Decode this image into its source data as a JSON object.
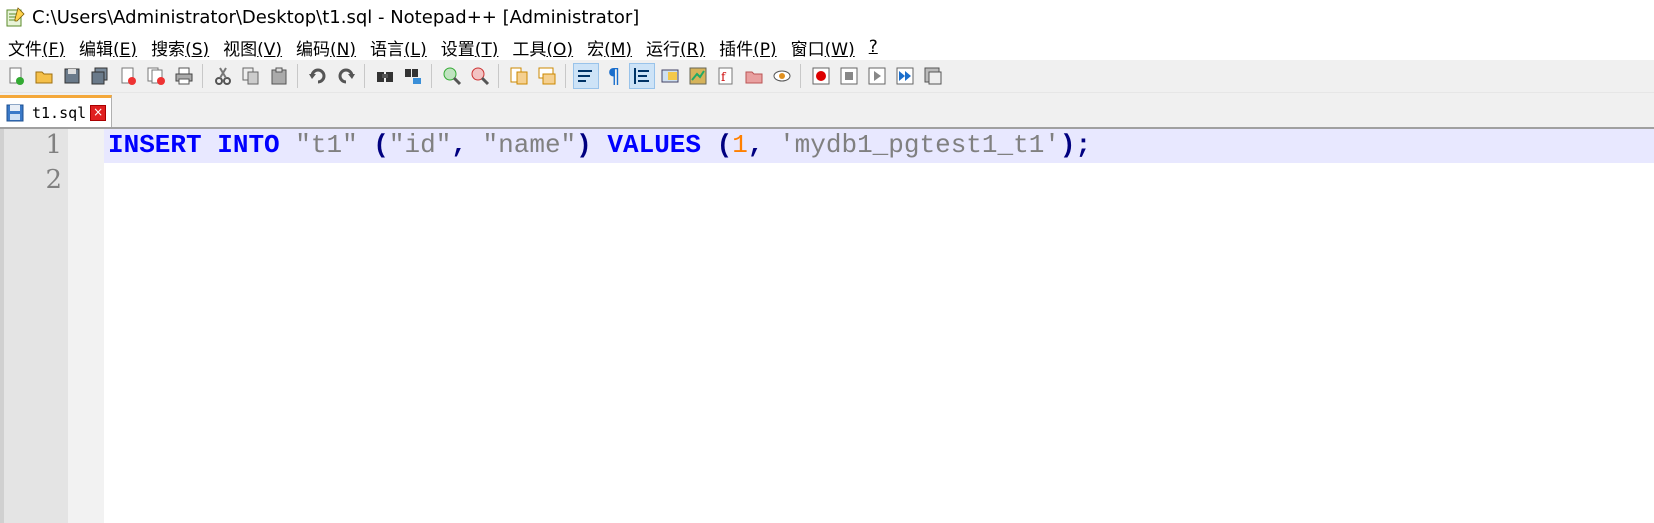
{
  "window": {
    "title": "C:\\Users\\Administrator\\Desktop\\t1.sql - Notepad++ [Administrator]"
  },
  "menu": [
    {
      "label": "文件",
      "hotkey": "(F)"
    },
    {
      "label": "编辑",
      "hotkey": "(E)"
    },
    {
      "label": "搜索",
      "hotkey": "(S)"
    },
    {
      "label": "视图",
      "hotkey": "(V)"
    },
    {
      "label": "编码",
      "hotkey": "(N)"
    },
    {
      "label": "语言",
      "hotkey": "(L)"
    },
    {
      "label": "设置",
      "hotkey": "(T)"
    },
    {
      "label": "工具",
      "hotkey": "(O)"
    },
    {
      "label": "宏",
      "hotkey": "(M)"
    },
    {
      "label": "运行",
      "hotkey": "(R)"
    },
    {
      "label": "插件",
      "hotkey": "(P)"
    },
    {
      "label": "窗口",
      "hotkey": "(W)"
    },
    {
      "label": "",
      "hotkey": "?"
    }
  ],
  "toolbar": {
    "icons": [
      "new-file-icon",
      "open-file-icon",
      "save-icon",
      "save-all-icon",
      "close-icon",
      "close-all-icon",
      "print-icon",
      "cut-icon",
      "copy-icon",
      "paste-icon",
      "undo-icon",
      "redo-icon",
      "find-icon",
      "replace-icon",
      "zoom-in-icon",
      "zoom-out-icon",
      "sync-vertical-icon",
      "sync-horizontal-icon",
      "word-wrap-icon",
      "show-all-chars-icon",
      "indent-guide-icon",
      "language-icon",
      "doc-map-icon",
      "function-list-icon",
      "folder-workspace-icon",
      "monitor-icon",
      "record-macro-icon",
      "stop-macro-icon",
      "play-macro-icon",
      "run-macro-multiple-icon",
      "save-macro-icon"
    ],
    "pilcrow": "¶"
  },
  "tabs": [
    {
      "label": "t1.sql",
      "close": "×"
    }
  ],
  "editor": {
    "line_numbers": [
      "1",
      "2"
    ],
    "line1": {
      "t1": "INSERT",
      "t2": " ",
      "t3": "INTO",
      "t4": " ",
      "t5": "\"t1\"",
      "t6": " ",
      "t7": "(",
      "t8": "\"id\"",
      "t9": ", ",
      "t10": "\"name\"",
      "t11": ")",
      "t12": " ",
      "t13": "VALUES",
      "t14": " ",
      "t15": "(",
      "t16": "1",
      "t17": ", ",
      "t18": "'mydb1_pgtest1_t1'",
      "t19": ");"
    }
  },
  "colors": {
    "keyword": "#0000ff",
    "string": "#808080",
    "number": "#ff8000",
    "operator": "#000080",
    "current_line": "#e8e8ff",
    "tab_accent": "#f4a83a"
  }
}
